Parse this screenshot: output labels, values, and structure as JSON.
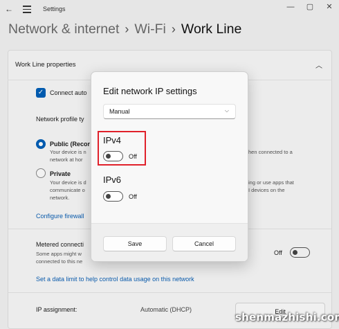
{
  "titlebar": {
    "title": "Settings",
    "back_icon": "back-arrow-icon",
    "menu_icon": "hamburger-menu-icon",
    "minimize": "—",
    "maximize": "▢",
    "close": "✕"
  },
  "breadcrumb": {
    "items": [
      "Network & internet",
      "Wi-Fi",
      "Work Line"
    ],
    "separator": "›"
  },
  "card": {
    "title": "Work Line properties",
    "connect_auto_label": "Connect auto",
    "network_profile_label": "Network profile ty",
    "public": {
      "label": "Public (Recor",
      "desc_line1": "Your device is n",
      "desc_line2": "network at hor",
      "desc_right": "hen connected to a"
    },
    "private": {
      "label": "Private",
      "desc_line1": "Your device is d",
      "desc_line2": "communicate o",
      "desc_line3": "network.",
      "desc_right1": "ing or use apps that",
      "desc_right2": "I devices on the"
    },
    "firewall_link": "Configure firewall",
    "metered": {
      "label": "Metered connecti",
      "desc_line1": "Some apps might w",
      "desc_line2": "connected to this ne",
      "state": "Off"
    },
    "data_limit_link": "Set a data limit to help control data usage on this network",
    "ip_assignment": {
      "label": "IP assignment:",
      "value": "Automatic (DHCP)",
      "edit_label": "Edit"
    }
  },
  "dialog": {
    "title": "Edit network IP settings",
    "mode_select": "Manual",
    "ipv4": {
      "label": "IPv4",
      "state": "Off"
    },
    "ipv6": {
      "label": "IPv6",
      "state": "Off"
    },
    "save_label": "Save",
    "cancel_label": "Cancel"
  },
  "colors": {
    "accent": "#005fb8",
    "link": "#0a5fb4",
    "highlight": "#e0202a"
  },
  "watermark": "shenmazhishi.com"
}
